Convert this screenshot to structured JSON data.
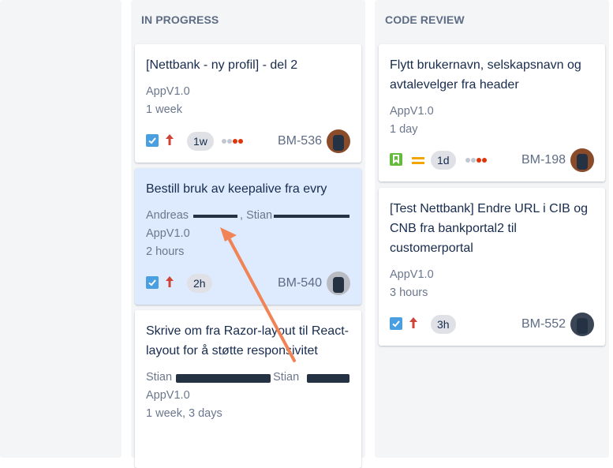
{
  "columns": {
    "in_progress": {
      "title": "IN PROGRESS",
      "cards": [
        {
          "title": "[Nettbank - ny profil] - del 2",
          "version": "AppV1.0",
          "time": "1 week",
          "estimate": "1w",
          "key": "BM-536"
        },
        {
          "title": "Bestill bruk av keepalive fra evry",
          "people_a": "Andreas",
          "people_b": ", Stian",
          "version": "AppV1.0",
          "time": "2 hours",
          "estimate": "2h",
          "key": "BM-540"
        },
        {
          "title": "Skrive om fra Razor-layout til React-layout for å støtte responsivitet",
          "people_a": "Stian",
          "people_b": ", Stian",
          "version": "AppV1.0",
          "time": "1 week, 3 days"
        }
      ]
    },
    "code_review": {
      "title": "CODE REVIEW",
      "cards": [
        {
          "title": "Flytt brukernavn, selskapsnavn og avtalevelger fra header",
          "version": "AppV1.0",
          "time": "1 day",
          "estimate": "1d",
          "key": "BM-198"
        },
        {
          "title": "[Test Nettbank] Endre URL i CIB og CNB fra bankportal2 til customerportal",
          "version": "AppV1.0",
          "time": "3 hours",
          "estimate": "3h",
          "key": "BM-552"
        }
      ]
    }
  },
  "icons": {
    "task_checkbox": "checkbox-icon",
    "story": "bookmark-icon",
    "priority_high": "arrow-up-icon",
    "priority_medium": "equals-icon"
  },
  "colors": {
    "column_bg": "#f4f5f7",
    "selected_card": "#deebff",
    "task_blue": "#4a9fe0",
    "story_green": "#63ba3c",
    "priority_red": "#d04437",
    "priority_orange": "#f0a500",
    "annotation_arrow": "#f08457"
  }
}
